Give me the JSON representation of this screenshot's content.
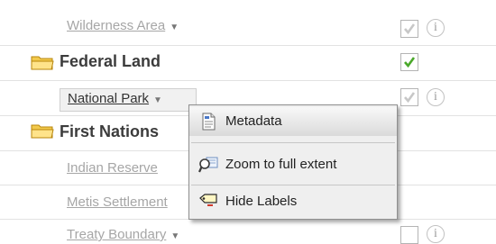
{
  "rows": {
    "wilderness": {
      "label": "Wilderness Area",
      "checked": true,
      "enabled": false
    },
    "federal": {
      "label": "Federal Land",
      "checked": true,
      "enabled": true
    },
    "national_park": {
      "label": "National Park",
      "checked": true,
      "enabled": false
    },
    "first_nations": {
      "label": "First Nations"
    },
    "indian_reserve": {
      "label": "Indian Reserve"
    },
    "metis": {
      "label": "Metis Settlement"
    },
    "treaty": {
      "label": "Treaty Boundary",
      "checked": false
    }
  },
  "dropdown_arrow": "▼",
  "info_symbol": "i",
  "context_menu": {
    "items": [
      {
        "label": "Metadata",
        "icon": "document-icon"
      },
      {
        "label": "Zoom to full extent",
        "icon": "zoom-extent-icon"
      },
      {
        "label": "Hide Labels",
        "icon": "label-tag-icon"
      }
    ]
  },
  "colors": {
    "check_green": "#4aa82a",
    "check_grey": "#c7c7c7",
    "folder_yellow": "#f2c94c",
    "menu_bg": "#efefef"
  }
}
